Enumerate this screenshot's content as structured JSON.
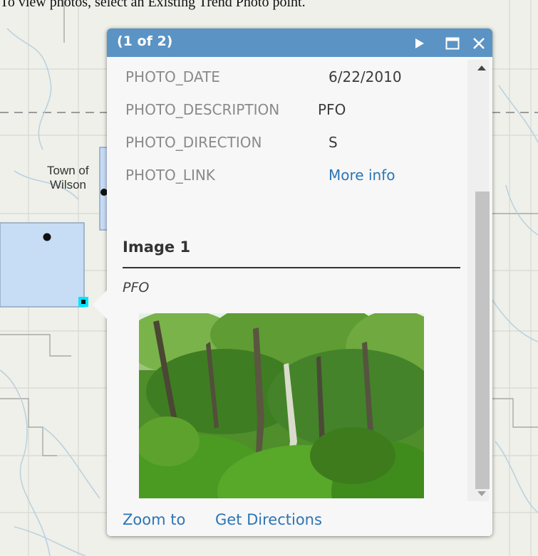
{
  "instruction": "To view photos, select an Existing Trend Photo point.",
  "map": {
    "place_label_line1": "Town of",
    "place_label_line2": "Wilson"
  },
  "popup": {
    "title": "(1 of 2)",
    "icons": {
      "next": "play-right-icon",
      "maximize": "maximize-icon",
      "close": "close-icon"
    },
    "attributes": [
      {
        "name": "PHOTO_DATE",
        "value": "6/22/2010"
      },
      {
        "name": "PHOTO_DESCRIPTION",
        "value": "PFO"
      },
      {
        "name": "PHOTO_DIRECTION",
        "value": "S"
      },
      {
        "name": "PHOTO_LINK",
        "value": "More info"
      }
    ],
    "media": {
      "title": "Image 1",
      "caption": "PFO"
    },
    "actions": {
      "zoom_to": "Zoom to",
      "get_directions": "Get Directions"
    }
  },
  "colors": {
    "titlebar": "#5b93c4",
    "link": "#2d74b5",
    "selected_polygon": "#c7dcf5",
    "selected_point": "#00e5ff"
  }
}
